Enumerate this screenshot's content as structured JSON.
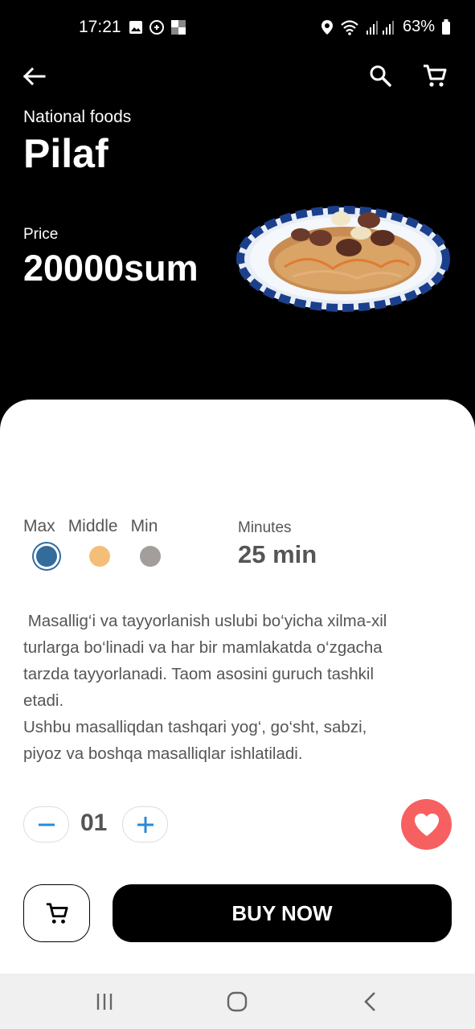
{
  "status_bar": {
    "time": "17:21",
    "battery": "63%",
    "icons": [
      "image-icon",
      "whatsapp-icon",
      "app-icon",
      "location-icon",
      "wifi-icon",
      "signal-icon",
      "battery-icon"
    ]
  },
  "top_nav": {
    "icons": [
      "back-arrow-icon",
      "search-icon",
      "cart-icon"
    ]
  },
  "product": {
    "category": "National foods",
    "name": "Pilaf",
    "price_label": "Price",
    "price": "20000sum"
  },
  "sizes": {
    "labels": [
      "Max",
      "Middle",
      "Min"
    ],
    "selected": "Max",
    "colors": {
      "max": "#336b9b",
      "middle": "#f4be79",
      "min": "#a39e9c"
    }
  },
  "cook_time": {
    "label": "Minutes",
    "value": "25 min"
  },
  "description": {
    "lines": [
      " Masallig‘i va tayyorlanish uslubi bo‘yicha xilma-xil",
      "turlarga bo‘linadi va har bir mamlakatda o‘zgacha",
      "tarzda tayyorlanadi. Taom asosini guruch tashkil",
      "etadi.",
      "Ushbu masalliqdan tashqari yog‘, go‘sht, sabzi,",
      "piyoz va boshqa masalliqlar ishlatiladi."
    ]
  },
  "quantity": {
    "value": "01"
  },
  "actions": {
    "buy_now": "BUY NOW",
    "favorite_color": "#f76060"
  },
  "colors": {
    "accent_blue": "#2a8ad6",
    "text_gray": "#555555"
  }
}
